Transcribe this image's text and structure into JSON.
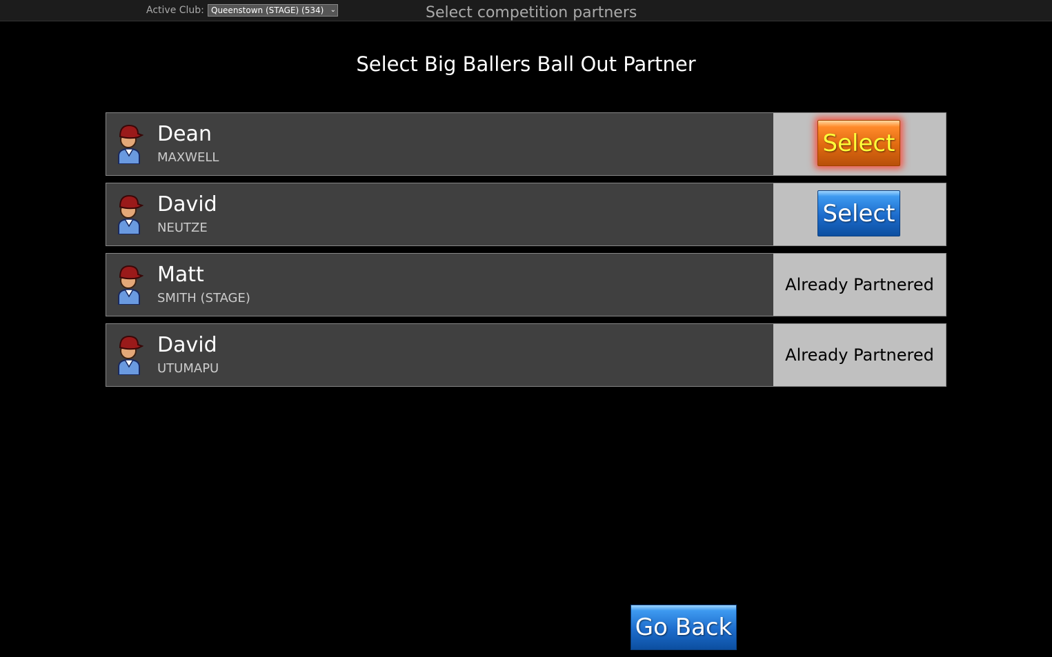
{
  "topbar": {
    "active_club_label": "Active Club:",
    "club_selected": "Queenstown (STAGE) (534)",
    "title": "Select competition partners"
  },
  "page_title": "Select Big Ballers Ball Out Partner",
  "players": [
    {
      "first": "Dean",
      "last": "MAXWELL",
      "action": "Select",
      "state": "highlighted"
    },
    {
      "first": "David",
      "last": "NEUTZE",
      "action": "Select",
      "state": "normal"
    },
    {
      "first": "Matt",
      "last": "SMITH (STAGE)",
      "action": "Already Partnered",
      "state": "partnered"
    },
    {
      "first": "David",
      "last": "UTUMAPU",
      "action": "Already Partnered",
      "state": "partnered"
    }
  ],
  "go_back_label": "Go Back",
  "colors": {
    "row_bg": "#404040",
    "action_bg": "#c0c0c0",
    "button_blue": "#1d6ccc",
    "button_orange": "#e06a10"
  }
}
